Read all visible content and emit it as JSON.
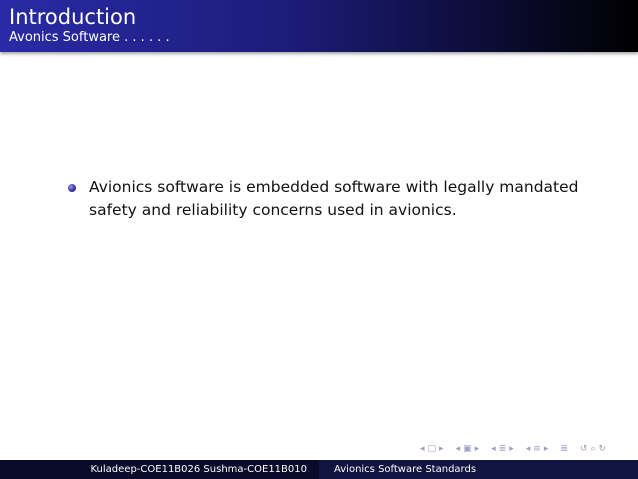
{
  "slide": {
    "title": "Introduction",
    "subtitle": "Avonics Software . . . . . .",
    "bullets": [
      {
        "text": "Avionics software is embedded software with legally mandated safety and reliability concerns used in avionics."
      }
    ]
  },
  "nav_icons": [
    "nav-first-icon",
    "nav-frame-prev-icon",
    "nav-section-prev-icon",
    "nav-subsection-prev-icon",
    "nav-search-icon"
  ],
  "footer": {
    "authors": "Kuladeep-COE11B026 Sushma-COE11B010",
    "short_title": "Avionics Software Standards"
  },
  "colors": {
    "header_start": "#2a2aa6",
    "header_end": "#000000",
    "footer_left": "#0a0a2a",
    "footer_right": "#111340",
    "bullet": "#3535a8"
  }
}
